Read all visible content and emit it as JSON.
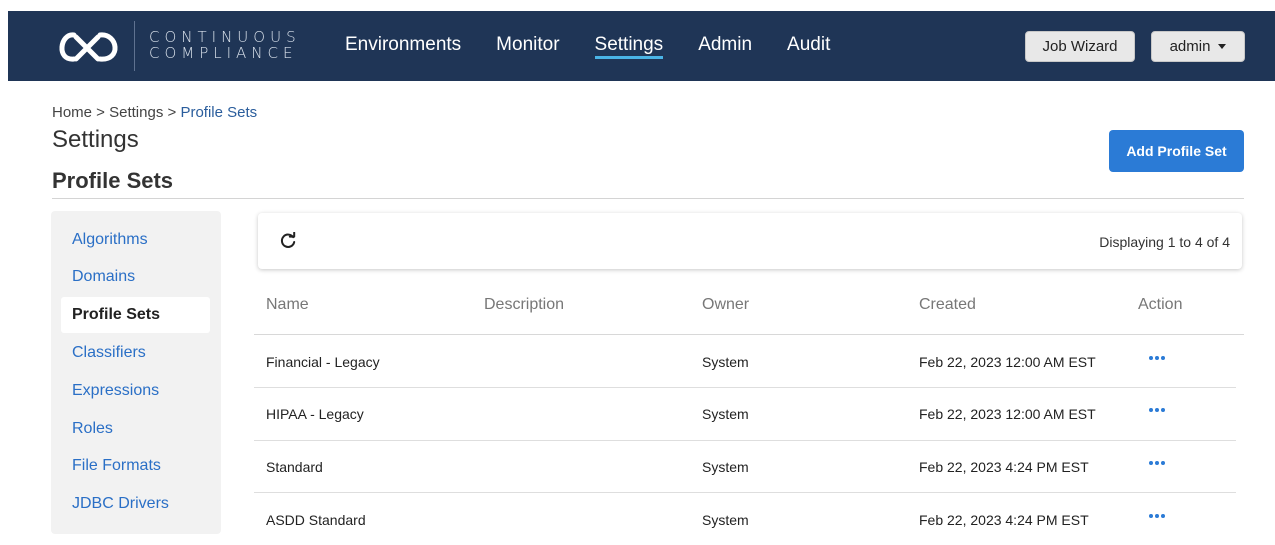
{
  "brand": {
    "line1": "CONTINUOUS",
    "line2": "COMPLIANCE",
    "logo_icon": "cx-logo-icon"
  },
  "nav": {
    "items": [
      {
        "label": "Environments",
        "active": false
      },
      {
        "label": "Monitor",
        "active": false
      },
      {
        "label": "Settings",
        "active": true
      },
      {
        "label": "Admin",
        "active": false
      },
      {
        "label": "Audit",
        "active": false
      }
    ],
    "job_wizard": "Job Wizard",
    "user_menu": "admin"
  },
  "breadcrumb": {
    "home": "Home",
    "sep1": " > ",
    "settings": "Settings",
    "sep2": " > ",
    "current": "Profile Sets"
  },
  "page_title": "Settings",
  "section_title": "Profile Sets",
  "add_button": "Add Profile Set",
  "sidebar": {
    "items": [
      {
        "label": "Algorithms"
      },
      {
        "label": "Domains"
      },
      {
        "label": "Profile Sets",
        "active": true
      },
      {
        "label": "Classifiers"
      },
      {
        "label": "Expressions"
      },
      {
        "label": "Roles"
      },
      {
        "label": "File Formats"
      },
      {
        "label": "JDBC Drivers"
      }
    ]
  },
  "toolbar": {
    "refresh_icon": "refresh-icon",
    "display_count": "Displaying 1 to 4 of 4"
  },
  "table": {
    "headers": {
      "name": "Name",
      "description": "Description",
      "owner": "Owner",
      "created": "Created",
      "action": "Action"
    },
    "rows": [
      {
        "name": "Financial - Legacy",
        "description": "",
        "owner": "System",
        "created": "Feb 22, 2023 12:00 AM EST",
        "action_icon": "more-options-icon"
      },
      {
        "name": "HIPAA - Legacy",
        "description": "",
        "owner": "System",
        "created": "Feb 22, 2023 12:00 AM EST",
        "action_icon": "more-options-icon"
      },
      {
        "name": "Standard",
        "description": "",
        "owner": "System",
        "created": "Feb 22, 2023 4:24 PM EST",
        "action_icon": "more-options-icon"
      },
      {
        "name": "ASDD Standard",
        "description": "",
        "owner": "System",
        "created": "Feb 22, 2023 4:24 PM EST",
        "action_icon": "more-options-icon"
      }
    ]
  },
  "colors": {
    "nav_bg": "#1f3556",
    "accent": "#2b7bd6",
    "active_underline": "#4ab4e6",
    "link": "#2a6fc6"
  }
}
